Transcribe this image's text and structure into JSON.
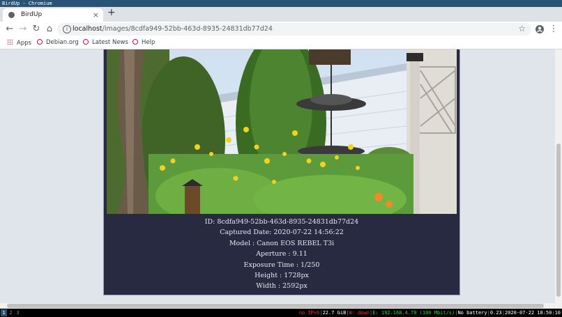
{
  "window": {
    "title": "BirdUp - Chromium"
  },
  "tab": {
    "title": "BirdUp",
    "close_glyph": "×",
    "new_tab_glyph": "+"
  },
  "toolbar": {
    "back_glyph": "←",
    "forward_glyph": "→",
    "reload_glyph": "↻",
    "home_glyph": "⌂",
    "url_host": "localhost",
    "url_path": "/images/8cdfa949-52bb-463d-8935-24831db77d24",
    "star_glyph": "☆",
    "menu_glyph": "⋮"
  },
  "bookmarks": [
    {
      "label": "Apps",
      "icon": "apps-grid-icon"
    },
    {
      "label": "Debian.org",
      "icon": "debian-icon"
    },
    {
      "label": "Latest News",
      "icon": "debian-icon"
    },
    {
      "label": "Help",
      "icon": "debian-icon"
    }
  ],
  "image_details": {
    "id": "ID: 8cdfa949-52bb-463d-8935-24831db77d24",
    "captured_date": "Captured Date: 2020-07-22 14:56:22",
    "model": "Model : Canon EOS REBEL T3i",
    "aperture": "Aperture : 9.11",
    "exposure_time": "Exposure Time : 1/250",
    "height": "Height : 1728px",
    "width": "Width : 2592px"
  },
  "statusbar": {
    "workspaces": [
      "1",
      "2",
      "3"
    ],
    "ipv6": "no IPv6",
    "disk": "22.7 GiB",
    "wifi": "W: down",
    "ethernet": "E: 192.168.4.70 (100 Mbit/s)",
    "battery": "No battery",
    "load": "0.23",
    "datetime": "2020-07-22 18:50:10"
  },
  "colors": {
    "accent": "#285577",
    "card_bg": "#272a40",
    "page_bg": "#dfe5ea"
  }
}
